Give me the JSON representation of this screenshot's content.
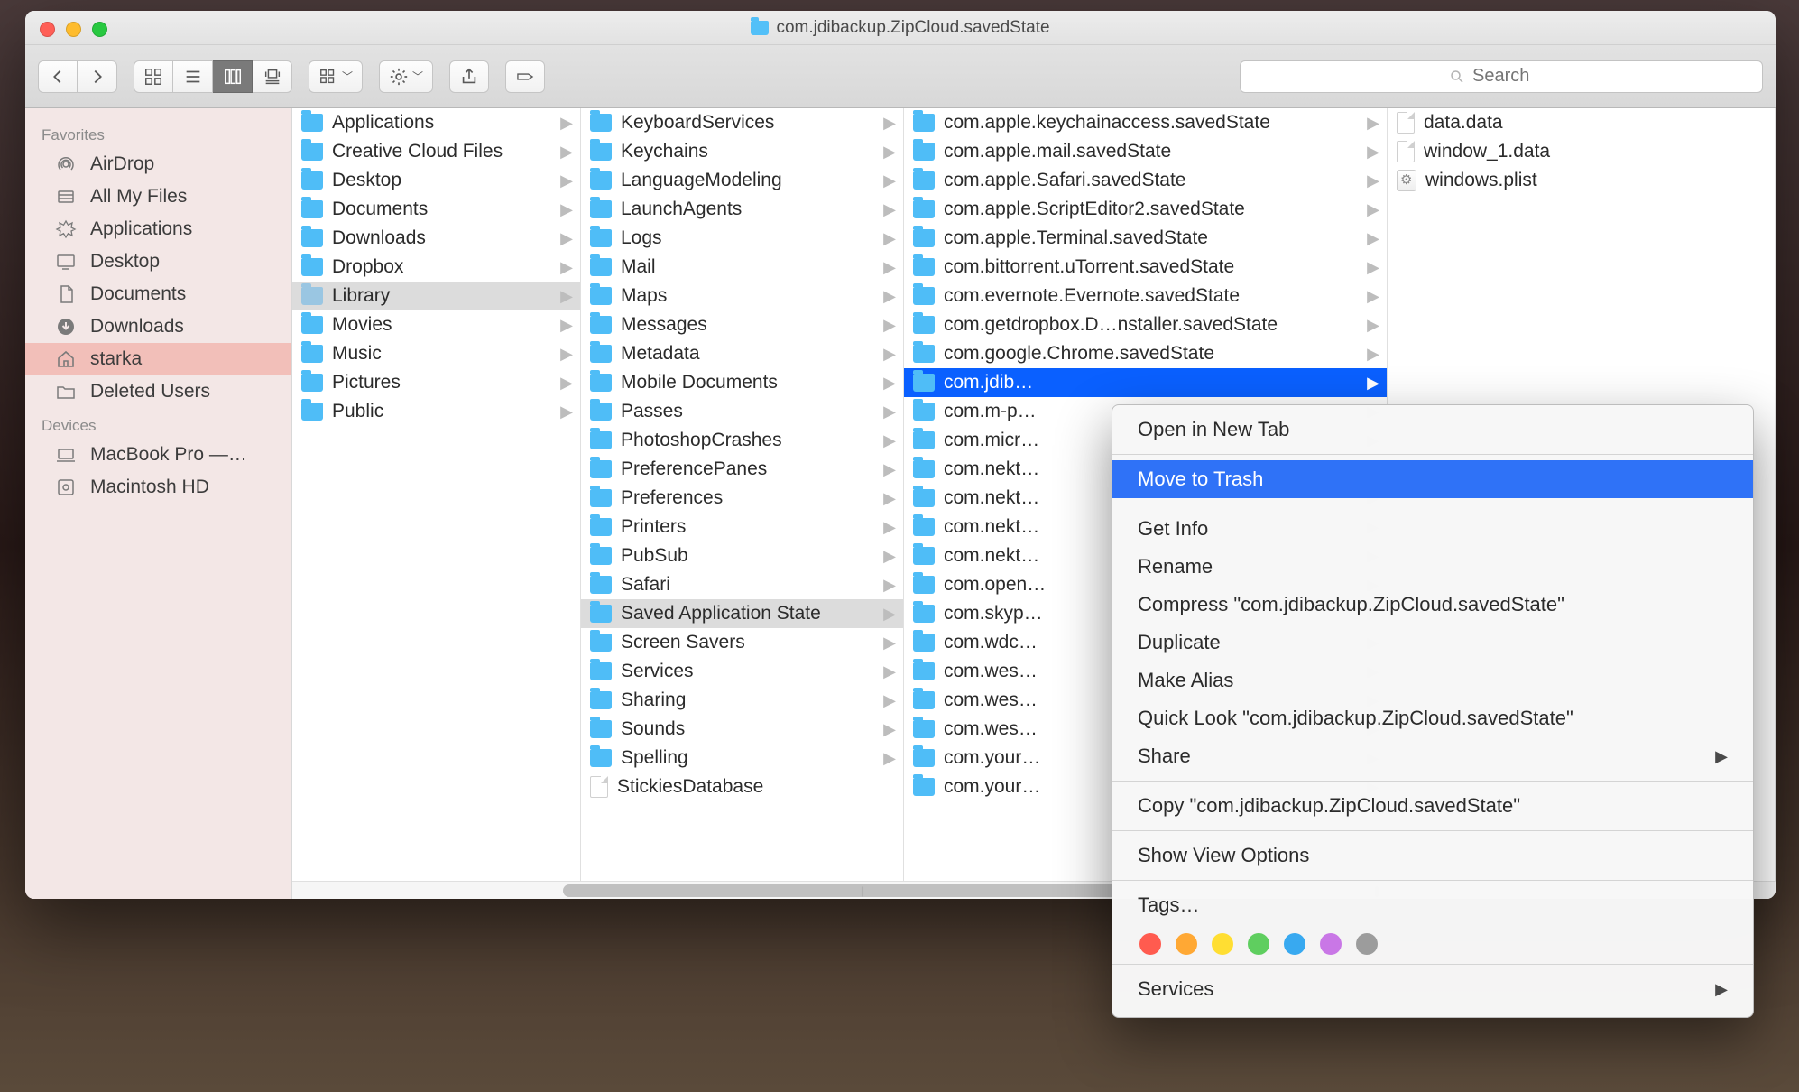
{
  "window": {
    "title": "com.jdibackup.ZipCloud.savedState"
  },
  "toolbar": {
    "search_placeholder": "Search"
  },
  "sidebar": {
    "sections": [
      {
        "header": "Favorites",
        "items": [
          {
            "label": "AirDrop",
            "icon": "airdrop"
          },
          {
            "label": "All My Files",
            "icon": "allfiles"
          },
          {
            "label": "Applications",
            "icon": "apps"
          },
          {
            "label": "Desktop",
            "icon": "desktop"
          },
          {
            "label": "Documents",
            "icon": "documents"
          },
          {
            "label": "Downloads",
            "icon": "downloads"
          },
          {
            "label": "starka",
            "icon": "home",
            "selected": true
          },
          {
            "label": "Deleted Users",
            "icon": "folder"
          }
        ]
      },
      {
        "header": "Devices",
        "items": [
          {
            "label": "MacBook Pro —…",
            "icon": "laptop"
          },
          {
            "label": "Macintosh HD",
            "icon": "disk"
          }
        ]
      }
    ]
  },
  "columns": [
    {
      "items": [
        {
          "label": "Applications",
          "type": "folder",
          "arrow": true
        },
        {
          "label": "Creative Cloud Files",
          "type": "folder",
          "arrow": true
        },
        {
          "label": "Desktop",
          "type": "folder",
          "arrow": true
        },
        {
          "label": "Documents",
          "type": "folder",
          "arrow": true
        },
        {
          "label": "Downloads",
          "type": "folder",
          "arrow": true
        },
        {
          "label": "Dropbox",
          "type": "folder",
          "arrow": true
        },
        {
          "label": "Library",
          "type": "folder-dim",
          "arrow": true,
          "selected": "dim"
        },
        {
          "label": "Movies",
          "type": "folder",
          "arrow": true
        },
        {
          "label": "Music",
          "type": "folder",
          "arrow": true
        },
        {
          "label": "Pictures",
          "type": "folder",
          "arrow": true
        },
        {
          "label": "Public",
          "type": "folder",
          "arrow": true
        }
      ]
    },
    {
      "items": [
        {
          "label": "KeyboardServices",
          "type": "folder",
          "arrow": true
        },
        {
          "label": "Keychains",
          "type": "folder",
          "arrow": true
        },
        {
          "label": "LanguageModeling",
          "type": "folder",
          "arrow": true
        },
        {
          "label": "LaunchAgents",
          "type": "folder",
          "arrow": true
        },
        {
          "label": "Logs",
          "type": "folder",
          "arrow": true
        },
        {
          "label": "Mail",
          "type": "folder",
          "arrow": true
        },
        {
          "label": "Maps",
          "type": "folder",
          "arrow": true
        },
        {
          "label": "Messages",
          "type": "folder",
          "arrow": true
        },
        {
          "label": "Metadata",
          "type": "folder",
          "arrow": true
        },
        {
          "label": "Mobile Documents",
          "type": "folder",
          "arrow": true
        },
        {
          "label": "Passes",
          "type": "folder",
          "arrow": true
        },
        {
          "label": "PhotoshopCrashes",
          "type": "folder",
          "arrow": true
        },
        {
          "label": "PreferencePanes",
          "type": "folder",
          "arrow": true
        },
        {
          "label": "Preferences",
          "type": "folder",
          "arrow": true
        },
        {
          "label": "Printers",
          "type": "folder",
          "arrow": true
        },
        {
          "label": "PubSub",
          "type": "folder",
          "arrow": true
        },
        {
          "label": "Safari",
          "type": "folder",
          "arrow": true
        },
        {
          "label": "Saved Application State",
          "type": "folder",
          "arrow": true,
          "selected": "dim"
        },
        {
          "label": "Screen Savers",
          "type": "folder",
          "arrow": true
        },
        {
          "label": "Services",
          "type": "folder",
          "arrow": true
        },
        {
          "label": "Sharing",
          "type": "folder",
          "arrow": true
        },
        {
          "label": "Sounds",
          "type": "folder",
          "arrow": true
        },
        {
          "label": "Spelling",
          "type": "folder",
          "arrow": true
        },
        {
          "label": "StickiesDatabase",
          "type": "file",
          "arrow": false
        }
      ]
    },
    {
      "items": [
        {
          "label": "com.apple.keychainaccess.savedState",
          "type": "folder",
          "arrow": true
        },
        {
          "label": "com.apple.mail.savedState",
          "type": "folder",
          "arrow": true
        },
        {
          "label": "com.apple.Safari.savedState",
          "type": "folder",
          "arrow": true
        },
        {
          "label": "com.apple.ScriptEditor2.savedState",
          "type": "folder",
          "arrow": true
        },
        {
          "label": "com.apple.Terminal.savedState",
          "type": "folder",
          "arrow": true
        },
        {
          "label": "com.bittorrent.uTorrent.savedState",
          "type": "folder",
          "arrow": true
        },
        {
          "label": "com.evernote.Evernote.savedState",
          "type": "folder",
          "arrow": true
        },
        {
          "label": "com.getdropbox.D…nstaller.savedState",
          "type": "folder",
          "arrow": true
        },
        {
          "label": "com.google.Chrome.savedState",
          "type": "folder",
          "arrow": true
        },
        {
          "label": "com.jdib…",
          "type": "folder",
          "arrow": true,
          "selected": "active"
        },
        {
          "label": "com.m-p…",
          "type": "folder",
          "arrow": true
        },
        {
          "label": "com.micr…",
          "type": "folder",
          "arrow": true
        },
        {
          "label": "com.nekt…",
          "type": "folder",
          "arrow": true
        },
        {
          "label": "com.nekt…",
          "type": "folder",
          "arrow": true
        },
        {
          "label": "com.nekt…",
          "type": "folder",
          "arrow": true
        },
        {
          "label": "com.nekt…",
          "type": "folder",
          "arrow": true
        },
        {
          "label": "com.open…",
          "type": "folder",
          "arrow": true
        },
        {
          "label": "com.skyp…",
          "type": "folder",
          "arrow": true
        },
        {
          "label": "com.wdc…",
          "type": "folder",
          "arrow": true
        },
        {
          "label": "com.wes…",
          "type": "folder",
          "arrow": true
        },
        {
          "label": "com.wes…",
          "type": "folder",
          "arrow": true
        },
        {
          "label": "com.wes…",
          "type": "folder",
          "arrow": true
        },
        {
          "label": "com.your…",
          "type": "folder",
          "arrow": true
        },
        {
          "label": "com.your…",
          "type": "folder",
          "arrow": true
        }
      ]
    },
    {
      "items": [
        {
          "label": "data.data",
          "type": "file",
          "arrow": false
        },
        {
          "label": "window_1.data",
          "type": "file",
          "arrow": false
        },
        {
          "label": "windows.plist",
          "type": "plist",
          "arrow": false
        }
      ]
    }
  ],
  "context_menu": {
    "items": [
      {
        "label": "Open in New Tab"
      },
      {
        "sep": true
      },
      {
        "label": "Move to Trash",
        "highlight": true
      },
      {
        "sep": true
      },
      {
        "label": "Get Info"
      },
      {
        "label": "Rename"
      },
      {
        "label": "Compress \"com.jdibackup.ZipCloud.savedState\""
      },
      {
        "label": "Duplicate"
      },
      {
        "label": "Make Alias"
      },
      {
        "label": "Quick Look \"com.jdibackup.ZipCloud.savedState\""
      },
      {
        "label": "Share",
        "submenu": true
      },
      {
        "sep": true
      },
      {
        "label": "Copy \"com.jdibackup.ZipCloud.savedState\""
      },
      {
        "sep": true
      },
      {
        "label": "Show View Options"
      },
      {
        "sep": true
      },
      {
        "label": "Tags…"
      }
    ],
    "tags": [
      "#ff5b4f",
      "#ffa834",
      "#ffde32",
      "#5fce5f",
      "#38a9f0",
      "#c977e6",
      "#9c9c9c"
    ],
    "services_label": "Services"
  }
}
